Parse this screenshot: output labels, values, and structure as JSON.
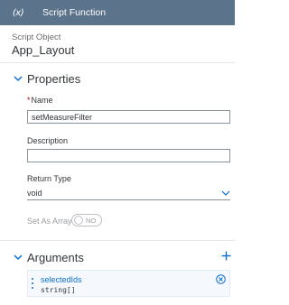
{
  "header": {
    "icon": "fx-icon",
    "icon_text": "(x)",
    "title": "Script Function"
  },
  "object": {
    "subtitle": "Script Object",
    "name": "App_Layout"
  },
  "properties": {
    "heading": "Properties",
    "name_label": "Name",
    "name_value": "setMeasureFilter",
    "description_label": "Description",
    "description_value": "",
    "return_type_label": "Return Type",
    "return_type_value": "void",
    "set_as_array_label": "Set As Array",
    "set_as_array_toggle": "NO"
  },
  "arguments": {
    "heading": "Arguments",
    "items": [
      {
        "name": "selectedIds",
        "type": "string[]"
      }
    ]
  },
  "colors": {
    "header_bg": "#5b738b",
    "accent": "#0a6ed1",
    "required": "#bb0000"
  }
}
